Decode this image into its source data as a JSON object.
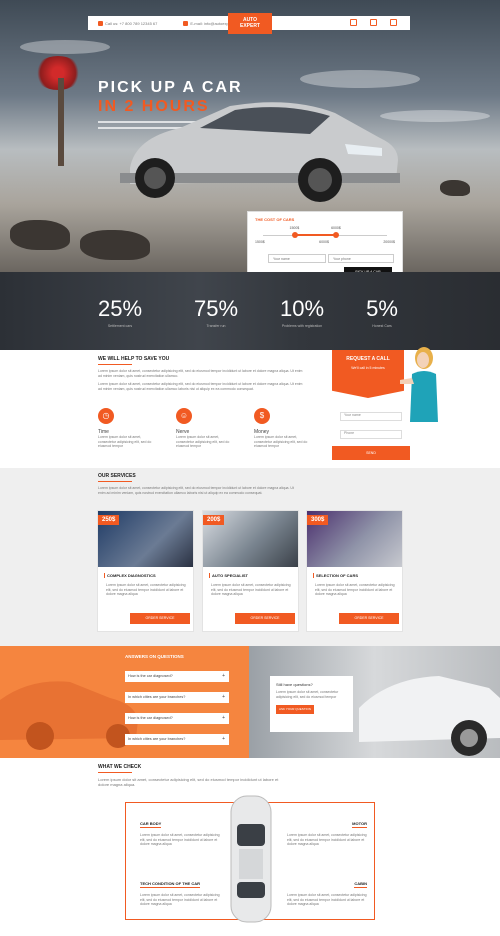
{
  "topbar": {
    "phone": "Call us: +7 800 789 12345 67",
    "email": "E-mail: info@autoexpert.ru",
    "logo_l1": "AUTO",
    "logo_l2": "EXPERT"
  },
  "hero": {
    "line1": "PICK UP A CAR",
    "line2": "IN 2 HOURS",
    "lines": [
      "Lorem ipsum dolor sit amet, consectetur adipisicing elit, sed do eiusmod tempor incididunt",
      "Lorem ipsum dolor sit amet, consectetur adipisicing elit, sed do eiusmod"
    ]
  },
  "cost": {
    "title": "THE COST OF CARS",
    "from": "1500$",
    "to": "6000$",
    "min": "1500$",
    "mid": "6000$",
    "max": "20000$",
    "name_ph": "Your name",
    "phone_ph": "Your phone",
    "button": "PICK UP A CAR",
    "range_low": 0.25,
    "range_high": 0.58
  },
  "stats": [
    {
      "value": "25%",
      "label": "Settlement cars"
    },
    {
      "value": "75%",
      "label": "Transfer run"
    },
    {
      "value": "10%",
      "label": "Problems with registration"
    },
    {
      "value": "5%",
      "label": "Honest Cars"
    }
  ],
  "save": {
    "title": "WE WILL HELP TO SAVE YOU",
    "p1": "Lorem ipsum dolor sit amet, consectetur adipisicing elit, sed do eiusmod tempor incididunt ut labore et dolore magna aliqua. Ut enim ad minim veniam, quis nostrud exercitation ullamco.",
    "p2": "Lorem ipsum dolor sit amet, consectetur adipisicing elit, sed do eiusmod tempor incididunt ut labore et dolore magna aliqua. Ut enim ad minim veniam, quis nostrud exercitation ullamco laboris nisi ut aliquip ex ea commodo consequat.",
    "features": [
      {
        "name": "Time",
        "text": "Lorem ipsum dolor sit amet, consectetur adipisicing elit, sed do eiusmod tempor"
      },
      {
        "name": "Nerve",
        "text": "Lorem ipsum dolor sit amet, consectetur adipisicing elit, sed do eiusmod tempor"
      },
      {
        "name": "Money",
        "text": "Lorem ipsum dolor sit amet, consectetur adipisicing elit, sed do eiusmod tempor"
      }
    ]
  },
  "request": {
    "title": "REQUEST A CALL",
    "sub": "We'll call in 5 minutes",
    "name_ph": "Your name",
    "phone_ph": "Phone",
    "button": "SEND"
  },
  "services": {
    "title": "OUR SERVICES",
    "intro": "Lorem ipsum dolor sit amet, consectetur adipisicing elit, sed do eiusmod tempor incididunt ut labore et dolore magna aliqua. Ut enim ad minim veniam, quis nostrud exercitation ullamco laboris nisi ut aliquip ex ea commodo consequat.",
    "cards": [
      {
        "price": "250$",
        "title": "COMPLEX DIAGNOSTICS",
        "text": "Lorem ipsum dolor sit amet, consectetur adipisicing elit, sed do eiusmod tempor incididunt ut labore et dolore magna aliqua",
        "button": "ORDER SERVICE"
      },
      {
        "price": "200$",
        "title": "AUTO SPECIALIST",
        "text": "Lorem ipsum dolor sit amet, consectetur adipisicing elit, sed do eiusmod tempor incididunt ut labore et dolore magna aliqua",
        "button": "ORDER SERVICE"
      },
      {
        "price": "300$",
        "title": "SELECTION OF CARS",
        "text": "Lorem ipsum dolor sit amet, consectetur adipisicing elit, sed do eiusmod tempor incididunt ut labore et dolore magna aliqua",
        "button": "ORDER SERVICE"
      }
    ]
  },
  "answers": {
    "title": "ANSWERS ON QUESTIONS",
    "questions": [
      "How is the car diagnosed?",
      "In which cities are your branches?",
      "How is the car diagnosed?",
      "In which cities are your branches?"
    ],
    "still_title": "Still have questions?",
    "still_text": "Lorem ipsum dolor sit amet, consectetur adipisicing elit, sed do eiusmod tempor",
    "still_button": "ASK YOUR QUESTION"
  },
  "check": {
    "title": "WHAT WE CHECK",
    "intro": "Lorem ipsum dolor sit amet, consectetur adipisicing elit, sed do eiusmod tempor incididunt ut labore et dolore magna aliqua.",
    "items": [
      {
        "title": "CAR BODY",
        "text": "Lorem ipsum dolor sit amet, consectetur adipisicing elit, sed do eiusmod tempor incididunt ut labore et dolore magna aliqua"
      },
      {
        "title": "MOTOR",
        "text": "Lorem ipsum dolor sit amet, consectetur adipisicing elit, sed do eiusmod tempor incididunt ut labore et dolore magna aliqua"
      },
      {
        "title": "TECH CONDITION OF THE CAR",
        "text": "Lorem ipsum dolor sit amet, consectetur adipisicing elit, sed do eiusmod tempor incididunt ut labore et dolore magna aliqua"
      },
      {
        "title": "CABIN",
        "text": "Lorem ipsum dolor sit amet, consectetur adipisicing elit, sed do eiusmod tempor incididunt ut labore et dolore magna aliqua"
      }
    ]
  },
  "colors": {
    "accent": "#f15a22",
    "dark": "#2c3036",
    "light_bg": "#efefef"
  }
}
